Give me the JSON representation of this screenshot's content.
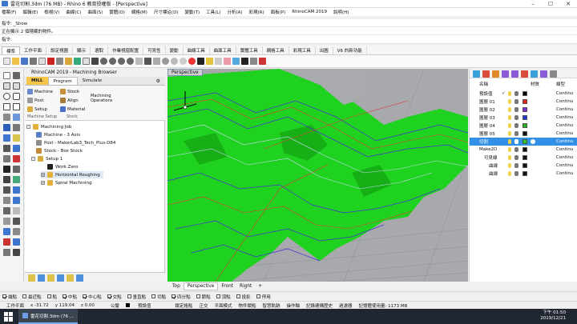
{
  "titlebar": {
    "title": "雷花切割.3dm (76 MB) - Rhino 6 教育授權版 - [Perspective]"
  },
  "menus": [
    "檔案(F)",
    "編輯(E)",
    "檢視(V)",
    "曲線(C)",
    "曲面(S)",
    "實體(O)",
    "網格(M)",
    "尺寸標註(D)",
    "變動(T)",
    "工具(L)",
    "分析(A)",
    "彩現(R)",
    "面板(P)",
    "RhinoCAM 2019",
    "說明(H)"
  ],
  "command": {
    "line1": "指令: _Show",
    "line2": "正在顯示 2 個隱藏的物件。",
    "prompt": "指令:"
  },
  "ribbon_tabs": [
    "標準",
    "工作平面",
    "設定視圖",
    "顯示",
    "選取",
    "作業視窗配置",
    "可見性",
    "變動",
    "曲線工具",
    "曲面工具",
    "實體工具",
    "網格工具",
    "彩現工具",
    "出圖",
    "V6 的新功能"
  ],
  "browser": {
    "title": "RhinoCAM 2019 - Machining Browser",
    "tabs": [
      "MILL",
      "Program",
      "Simulate"
    ],
    "buttons": {
      "machine": "Machine",
      "stock": "Stock",
      "post": "Post",
      "align": "Align",
      "setup": "Setup",
      "material": "Material",
      "machining_ops": "Machining Operations",
      "machine_setup": "Machine Setup",
      "stock_group": "Stock"
    },
    "tree": {
      "job": "Machining Job",
      "machine": "Machine - 3 Axis",
      "post": "Post - MakerLab3_Tech_Plus-D84",
      "stock": "Stock - Box Stock",
      "setup": "Setup 1",
      "work_zero": "Work Zero",
      "op1": "Horizontal Roughing",
      "op2": "Spiral Machining"
    }
  },
  "viewport": {
    "label": "Perspective",
    "tabs": [
      "Top",
      "Perspective",
      "Front",
      "Right",
      "+"
    ]
  },
  "layers": {
    "columns": {
      "name": "名稱",
      "material": "材質",
      "linetype": "線型"
    },
    "rows": [
      {
        "name": "預設值",
        "current": "✓",
        "color": "#000000",
        "linetype": "Continu",
        "indent": 0
      },
      {
        "name": "圖層 01",
        "current": "",
        "color": "#e62020",
        "linetype": "Continu",
        "indent": 0
      },
      {
        "name": "圖層 02",
        "current": "",
        "color": "#7a2ad6",
        "linetype": "Continu",
        "indent": 0
      },
      {
        "name": "圖層 03",
        "current": "",
        "color": "#2233dd",
        "linetype": "Continu",
        "indent": 0
      },
      {
        "name": "圖層 04",
        "current": "",
        "color": "#22aa22",
        "linetype": "Continu",
        "indent": 0
      },
      {
        "name": "圖層 05",
        "current": "",
        "color": "#111111",
        "linetype": "Continu",
        "indent": 0
      },
      {
        "name": "切割",
        "current": "",
        "color": "#22cc22",
        "linetype": "Continu",
        "indent": 0,
        "selected": true
      },
      {
        "name": "Make2D",
        "current": "",
        "color": "#111111",
        "linetype": "Continu",
        "indent": 0
      },
      {
        "name": "可見線",
        "current": "",
        "color": "#111111",
        "linetype": "Continu",
        "indent": 1
      },
      {
        "name": "曲線",
        "current": "",
        "color": "#111111",
        "linetype": "Continu",
        "indent": 2
      },
      {
        "name": "曲線",
        "current": "",
        "color": "#111111",
        "linetype": "Continu",
        "indent": 2
      }
    ]
  },
  "osnap": [
    {
      "label": "端點",
      "checked": true
    },
    {
      "label": "最近點",
      "checked": false
    },
    {
      "label": "點",
      "checked": false
    },
    {
      "label": "中點",
      "checked": true
    },
    {
      "label": "中心點",
      "checked": true
    },
    {
      "label": "交點",
      "checked": true
    },
    {
      "label": "垂直點",
      "checked": false
    },
    {
      "label": "切點",
      "checked": false
    },
    {
      "label": "四分點",
      "checked": true
    },
    {
      "label": "節點",
      "checked": false
    },
    {
      "label": "頂點",
      "checked": false
    },
    {
      "label": "投影",
      "checked": false
    },
    {
      "label": "停用",
      "checked": false
    }
  ],
  "status": {
    "cplane": "工作平面",
    "x": "x -31.72",
    "y": "y 119.04",
    "z": "z 0.00",
    "unit": "公釐",
    "layer": "預設值",
    "items": [
      "鎖定格點",
      "正交",
      "平面模式",
      "物件鎖點",
      "智慧軌跡",
      "操作軸",
      "記錄建構歷史",
      "過濾器",
      "記憶體使用量: 1173 MB"
    ]
  },
  "taskbar": {
    "app": "雷花切割.3dm (76 ...",
    "time": "下午 01:50",
    "date": "2019/12/21"
  }
}
